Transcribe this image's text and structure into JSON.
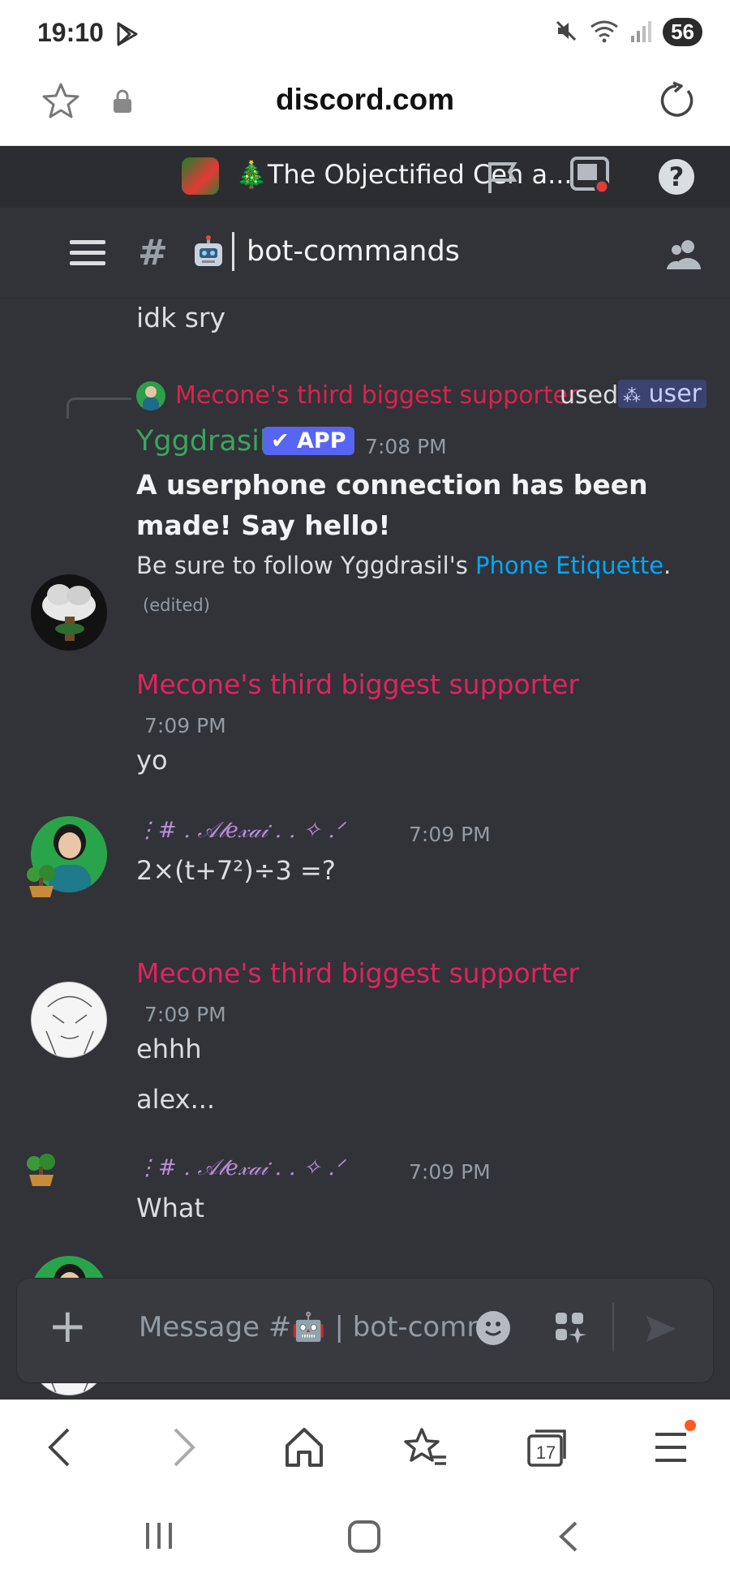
{
  "status_bar": {
    "time": "19:10",
    "battery": "56"
  },
  "browser": {
    "url": "discord.com"
  },
  "guild": {
    "name": "🎄The Objectified Cen a..."
  },
  "channel": {
    "name": "bot-commands"
  },
  "messages": {
    "partial_text": "idk sry",
    "reply": {
      "user": "Mecone's third biggest supporter",
      "used": "used",
      "command": "user"
    },
    "bot": {
      "name": "Yggdrasil",
      "badge": "APP",
      "time": "7:08 PM",
      "line1": "A userphone connection has been",
      "line2": "made! Say hello!",
      "etiquette_prefix": "Be sure to follow Yggdrasil's ",
      "etiquette_link": "Phone Etiquette",
      "etiquette_suffix": ".",
      "edited": "(edited)"
    },
    "msg1": {
      "name": "Mecone's third biggest supporter",
      "time": "7:09 PM",
      "text": "yo"
    },
    "msg2": {
      "name": "⋮# . 𝒜𝓁𝑒𝓍𝒶𝒾 . . ✧ .ᐟ",
      "time": "7:09 PM",
      "text": "2×(t+7²)÷3 =?"
    },
    "msg3": {
      "name": "Mecone's third biggest supporter",
      "time": "7:09 PM",
      "text1": "ehhh",
      "text2": "alex..."
    },
    "msg4": {
      "name": "⋮# . 𝒜𝓁𝑒𝓍𝒶𝒾 . . ✧ .ᐟ",
      "time": "7:09 PM",
      "text": "What"
    }
  },
  "composer": {
    "placeholder": "Message #🤖 | bot-comm"
  },
  "bottom_nav": {
    "tabs_count": "17"
  },
  "colors": {
    "mecone": "#e0245e",
    "mecone_reply": "#d9234f",
    "alexai": "#b98cd8",
    "yggdrasil": "#3ba55d",
    "link": "#00a8fc",
    "app_badge": "#5865f2"
  }
}
